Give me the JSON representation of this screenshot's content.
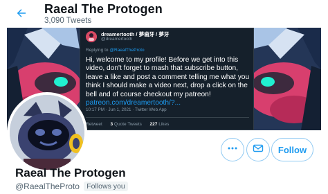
{
  "header": {
    "title": "Raeal The Protogen",
    "tweet_count": "3,090 Tweets"
  },
  "banner_tweet": {
    "author_name": "dreamertooth / 夢歯牙 / 夢牙",
    "author_handle": "@dreamertooth",
    "replying_prefix": "Replying to",
    "replying_to": "@RaealTheProto",
    "body": "Hi, welcome to my profile! Before we get into this video, don't forget to mash that subscribe button, leave a like and post a comment telling me what you think I should make a video next, drop a click on the bell and of course checkout my patreon!",
    "link": "patreon.com/dreamertooth/?...",
    "meta": "10:17 PM · Jun 1, 2021 · Twitter Web App",
    "retweets_label": "Retweet",
    "quote_count": "3",
    "quote_label": "Quote Tweets",
    "likes_count": "227",
    "likes_label": "Likes"
  },
  "profile": {
    "name": "Raeal The Protogen",
    "handle": "@RaealTheProto",
    "follows_you": "Follows you"
  },
  "actions": {
    "follow_label": "Follow",
    "more_icon": "more-dots-icon",
    "message_icon": "envelope-icon"
  },
  "colors": {
    "accent": "#1d9bf0",
    "tweet_bg": "#15202b",
    "banner_bg": "#1d2538"
  }
}
